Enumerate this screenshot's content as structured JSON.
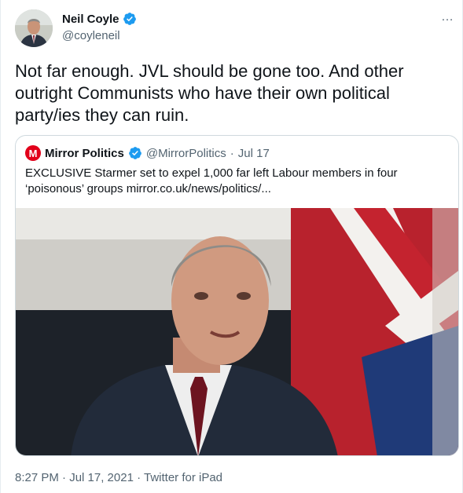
{
  "author": {
    "name": "Neil Coyle",
    "handle": "@coyleneil",
    "verified_color": "#1d9bf0"
  },
  "more_icon": "…",
  "tweet": {
    "text": "Not far enough. JVL should be gone too. And other outright Communists who have their own political party/ies they can ruin."
  },
  "quoted": {
    "logo_letter": "M",
    "logo_color": "#e2001a",
    "name": "Mirror Politics",
    "handle": "@MirrorPolitics",
    "separator": "·",
    "date": "Jul 17",
    "text": "EXCLUSIVE Starmer set to expel 1,000 far left Labour members in four ‘poisonous’ groups mirror.co.uk/news/politics/..."
  },
  "meta": {
    "text": "8:27 PM · Jul 17, 2021 · Twitter for iPad"
  },
  "icons": [
    "verified-badge-icon",
    "more-options-icon",
    "mirror-logo-icon"
  ]
}
